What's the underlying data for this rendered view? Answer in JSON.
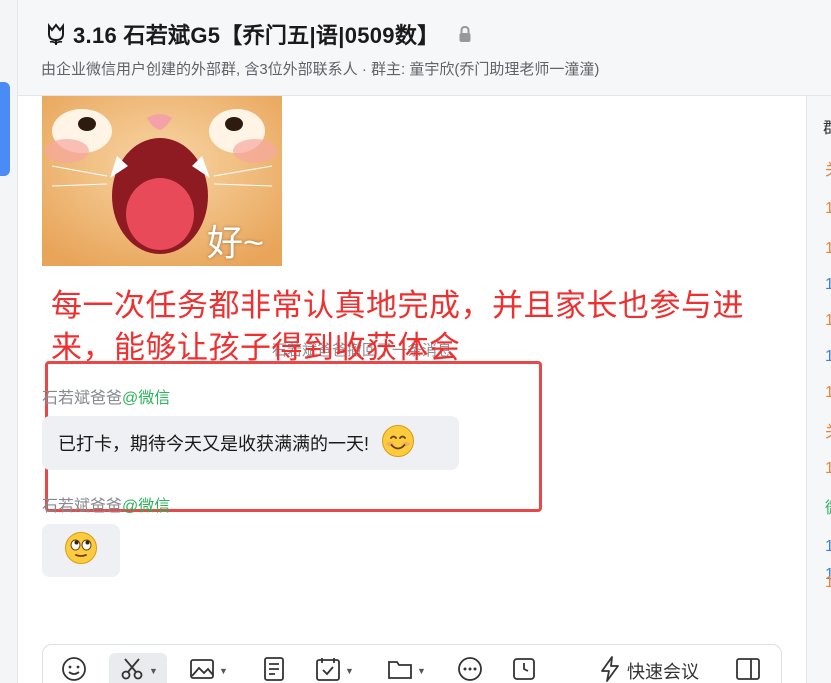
{
  "header": {
    "title": "3.16 石若斌G5【乔门五|语|0509数】",
    "subtitle": "由企业微信用户创建的外部群, 含3位外部联系人 · 群主: 童宇欣(乔门助理老师一潼潼)"
  },
  "messages": {
    "image_caption": "好~",
    "overlay_text": "每一次任务都非常认真地完成，并且家长也参与进来，能够让孩子得到收获体会",
    "recall_notice": "石若斌爸爸撤回了一条消息",
    "msg1": {
      "sender": "石若斌爸爸",
      "sender_tag": "@微信",
      "text": "已打卡，期待今天又是收获满满的一天!"
    },
    "msg2": {
      "sender": "石若斌爸爸",
      "sender_tag": "@微信"
    }
  },
  "toolbar": {
    "quick_meeting_label": "快速会议"
  },
  "right_panel": {
    "heading": "群",
    "marks": [
      {
        "text": "关",
        "color": "#e8843a"
      },
      {
        "text": "1",
        "color": "#e8843a"
      },
      {
        "text": "1",
        "color": "#e8843a"
      },
      {
        "text": "1",
        "color": "#3f7fd9"
      },
      {
        "text": "1",
        "color": "#e8843a"
      },
      {
        "text": "1",
        "color": "#3f7fd9"
      },
      {
        "text": "1",
        "color": "#e8843a"
      },
      {
        "text": "关",
        "color": "#e8843a"
      },
      {
        "text": "1",
        "color": "#e8843a"
      },
      {
        "text": "微",
        "color": "#2bb35a"
      },
      {
        "text": "1",
        "color": "#3f7fd9"
      },
      {
        "text": "1",
        "color": "#3f7fd9"
      },
      {
        "text": "1",
        "color": "#e8843a"
      }
    ]
  },
  "colors": {
    "accent": "#4b8bf5",
    "annotation_red": "#ee3030",
    "wechat_green": "#2bb35a"
  }
}
